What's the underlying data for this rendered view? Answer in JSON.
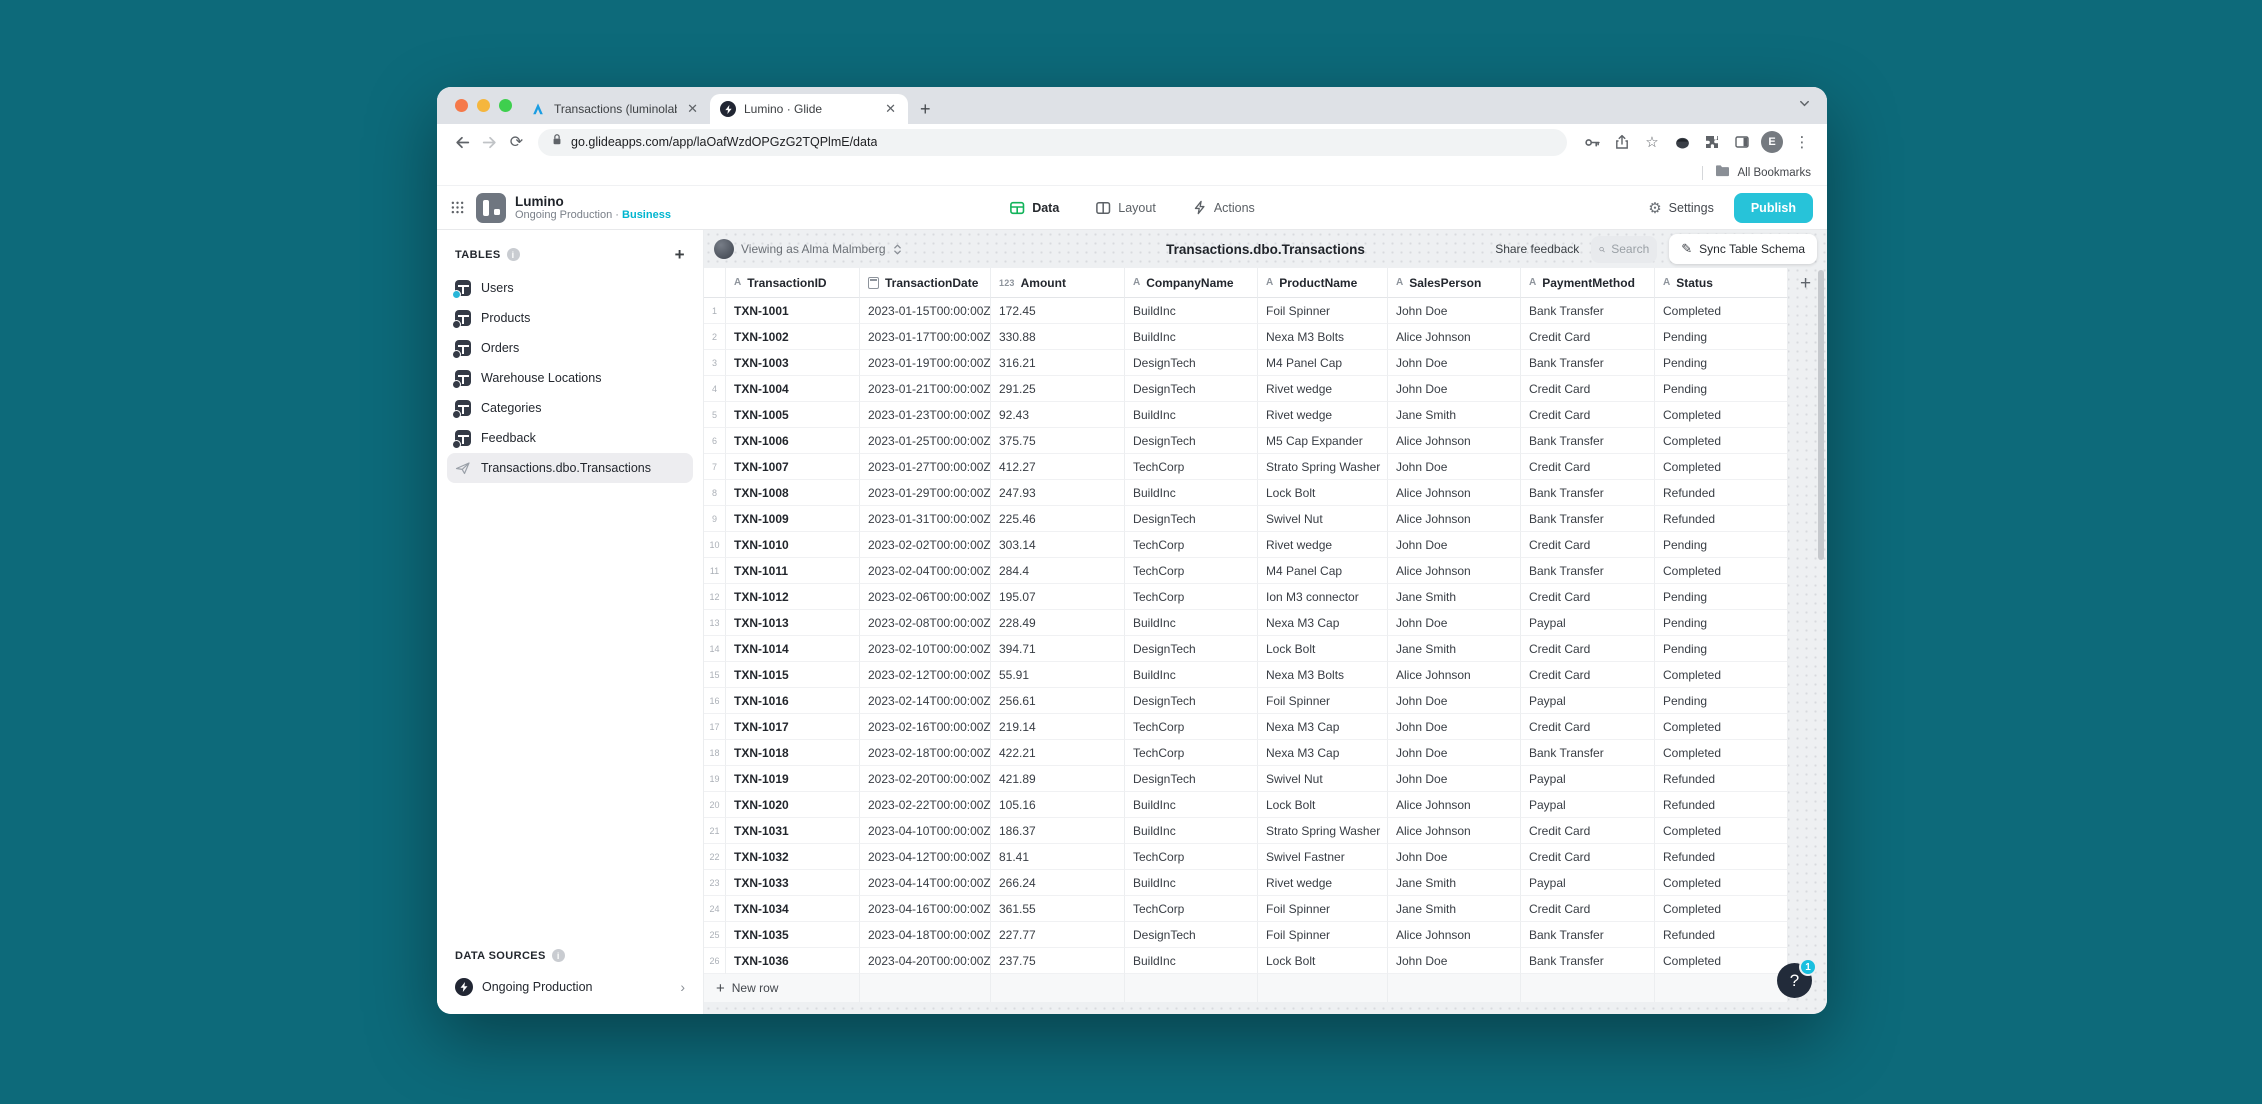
{
  "browser": {
    "tabs": [
      {
        "title": "Transactions (luminolabs/Trans",
        "favicon": "azure-data-studio"
      },
      {
        "title": "Lumino · Glide",
        "favicon": "glide",
        "active": true
      }
    ],
    "url": "go.glideapps.com/app/laOafWzdOPGzG2TQPlmE/data",
    "bookmarks_label": "All Bookmarks",
    "profile_initial": "E"
  },
  "app_header": {
    "app_name": "Lumino",
    "app_subtitle": "Ongoing Production",
    "subtitle_separator": "·",
    "app_plan": "Business",
    "nav_tabs": [
      {
        "label": "Data",
        "active": true
      },
      {
        "label": "Layout",
        "active": false
      },
      {
        "label": "Actions",
        "active": false
      }
    ],
    "settings_label": "Settings",
    "publish_label": "Publish"
  },
  "sidebar": {
    "tables_heading": "TABLES",
    "items": [
      {
        "label": "Users",
        "badge": "cyan"
      },
      {
        "label": "Products",
        "badge": "dark"
      },
      {
        "label": "Orders",
        "badge": "dark"
      },
      {
        "label": "Warehouse Locations",
        "badge": "dark"
      },
      {
        "label": "Categories",
        "badge": "dark"
      },
      {
        "label": "Feedback",
        "badge": "dark"
      },
      {
        "label": "Transactions.dbo.Transactions",
        "selected": true,
        "icon": "sql-plane"
      }
    ],
    "data_sources_heading": "DATA SOURCES",
    "data_source_label": "Ongoing Production"
  },
  "toolbar": {
    "viewing_as": "Viewing as Alma Malmberg",
    "title": "Transactions.dbo.Transactions",
    "share_feedback_label": "Share feedback",
    "search_placeholder": "Search",
    "sync_button_label": "Sync Table Schema"
  },
  "grid": {
    "columns": [
      {
        "name": "TransactionID",
        "type": "text"
      },
      {
        "name": "TransactionDate",
        "type": "date"
      },
      {
        "name": "Amount",
        "type": "number"
      },
      {
        "name": "CompanyName",
        "type": "text"
      },
      {
        "name": "ProductName",
        "type": "text"
      },
      {
        "name": "SalesPerson",
        "type": "text"
      },
      {
        "name": "PaymentMethod",
        "type": "text"
      },
      {
        "name": "Status",
        "type": "text"
      }
    ],
    "rows": [
      [
        "TXN-1001",
        "2023-01-15T00:00:00Z",
        "172.45",
        "BuildInc",
        "Foil Spinner",
        "John Doe",
        "Bank Transfer",
        "Completed"
      ],
      [
        "TXN-1002",
        "2023-01-17T00:00:00Z",
        "330.88",
        "BuildInc",
        "Nexa M3 Bolts",
        "Alice Johnson",
        "Credit Card",
        "Pending"
      ],
      [
        "TXN-1003",
        "2023-01-19T00:00:00Z",
        "316.21",
        "DesignTech",
        "M4 Panel Cap",
        "John Doe",
        "Bank Transfer",
        "Pending"
      ],
      [
        "TXN-1004",
        "2023-01-21T00:00:00Z",
        "291.25",
        "DesignTech",
        "Rivet wedge",
        "John Doe",
        "Credit Card",
        "Pending"
      ],
      [
        "TXN-1005",
        "2023-01-23T00:00:00Z",
        "92.43",
        "BuildInc",
        "Rivet wedge",
        "Jane Smith",
        "Credit Card",
        "Completed"
      ],
      [
        "TXN-1006",
        "2023-01-25T00:00:00Z",
        "375.75",
        "DesignTech",
        "M5 Cap Expander",
        "Alice Johnson",
        "Bank Transfer",
        "Completed"
      ],
      [
        "TXN-1007",
        "2023-01-27T00:00:00Z",
        "412.27",
        "TechCorp",
        "Strato Spring Washer",
        "John Doe",
        "Credit Card",
        "Completed"
      ],
      [
        "TXN-1008",
        "2023-01-29T00:00:00Z",
        "247.93",
        "BuildInc",
        "Lock Bolt",
        "Alice Johnson",
        "Bank Transfer",
        "Refunded"
      ],
      [
        "TXN-1009",
        "2023-01-31T00:00:00Z",
        "225.46",
        "DesignTech",
        "Swivel Nut",
        "Alice Johnson",
        "Bank Transfer",
        "Refunded"
      ],
      [
        "TXN-1010",
        "2023-02-02T00:00:00Z",
        "303.14",
        "TechCorp",
        "Rivet wedge",
        "John Doe",
        "Credit Card",
        "Pending"
      ],
      [
        "TXN-1011",
        "2023-02-04T00:00:00Z",
        "284.4",
        "TechCorp",
        "M4 Panel Cap",
        "Alice Johnson",
        "Bank Transfer",
        "Completed"
      ],
      [
        "TXN-1012",
        "2023-02-06T00:00:00Z",
        "195.07",
        "TechCorp",
        "Ion M3 connector",
        "Jane Smith",
        "Credit Card",
        "Pending"
      ],
      [
        "TXN-1013",
        "2023-02-08T00:00:00Z",
        "228.49",
        "BuildInc",
        "Nexa M3 Cap",
        "John Doe",
        "Paypal",
        "Pending"
      ],
      [
        "TXN-1014",
        "2023-02-10T00:00:00Z",
        "394.71",
        "DesignTech",
        "Lock Bolt",
        "Jane Smith",
        "Credit Card",
        "Pending"
      ],
      [
        "TXN-1015",
        "2023-02-12T00:00:00Z",
        "55.91",
        "BuildInc",
        "Nexa M3 Bolts",
        "Alice Johnson",
        "Credit Card",
        "Completed"
      ],
      [
        "TXN-1016",
        "2023-02-14T00:00:00Z",
        "256.61",
        "DesignTech",
        "Foil Spinner",
        "John Doe",
        "Paypal",
        "Pending"
      ],
      [
        "TXN-1017",
        "2023-02-16T00:00:00Z",
        "219.14",
        "TechCorp",
        "Nexa M3 Cap",
        "John Doe",
        "Credit Card",
        "Completed"
      ],
      [
        "TXN-1018",
        "2023-02-18T00:00:00Z",
        "422.21",
        "TechCorp",
        "Nexa M3 Cap",
        "John Doe",
        "Bank Transfer",
        "Completed"
      ],
      [
        "TXN-1019",
        "2023-02-20T00:00:00Z",
        "421.89",
        "DesignTech",
        "Swivel Nut",
        "John Doe",
        "Paypal",
        "Refunded"
      ],
      [
        "TXN-1020",
        "2023-02-22T00:00:00Z",
        "105.16",
        "BuildInc",
        "Lock Bolt",
        "Alice Johnson",
        "Paypal",
        "Refunded"
      ],
      [
        "TXN-1031",
        "2023-04-10T00:00:00Z",
        "186.37",
        "BuildInc",
        "Strato Spring Washer",
        "Alice Johnson",
        "Credit Card",
        "Completed"
      ],
      [
        "TXN-1032",
        "2023-04-12T00:00:00Z",
        "81.41",
        "TechCorp",
        "Swivel Fastner",
        "John Doe",
        "Credit Card",
        "Refunded"
      ],
      [
        "TXN-1033",
        "2023-04-14T00:00:00Z",
        "266.24",
        "BuildInc",
        "Rivet wedge",
        "Jane Smith",
        "Paypal",
        "Completed"
      ],
      [
        "TXN-1034",
        "2023-04-16T00:00:00Z",
        "361.55",
        "TechCorp",
        "Foil Spinner",
        "Jane Smith",
        "Credit Card",
        "Completed"
      ],
      [
        "TXN-1035",
        "2023-04-18T00:00:00Z",
        "227.77",
        "DesignTech",
        "Foil Spinner",
        "Alice Johnson",
        "Bank Transfer",
        "Refunded"
      ],
      [
        "TXN-1036",
        "2023-04-20T00:00:00Z",
        "237.75",
        "BuildInc",
        "Lock Bolt",
        "John Doe",
        "Bank Transfer",
        "Completed"
      ]
    ],
    "new_row_label": "New row"
  },
  "help": {
    "glyph": "?",
    "badge_count": "1"
  },
  "colors": {
    "desktop_background": "#0d6a7a",
    "publish_button": "#27c3d9",
    "plan_text": "#00b5cf",
    "data_tab_icon": "#12b35a",
    "help_badge": "#19bfdf",
    "selected_item_bg": "#ededf0"
  }
}
